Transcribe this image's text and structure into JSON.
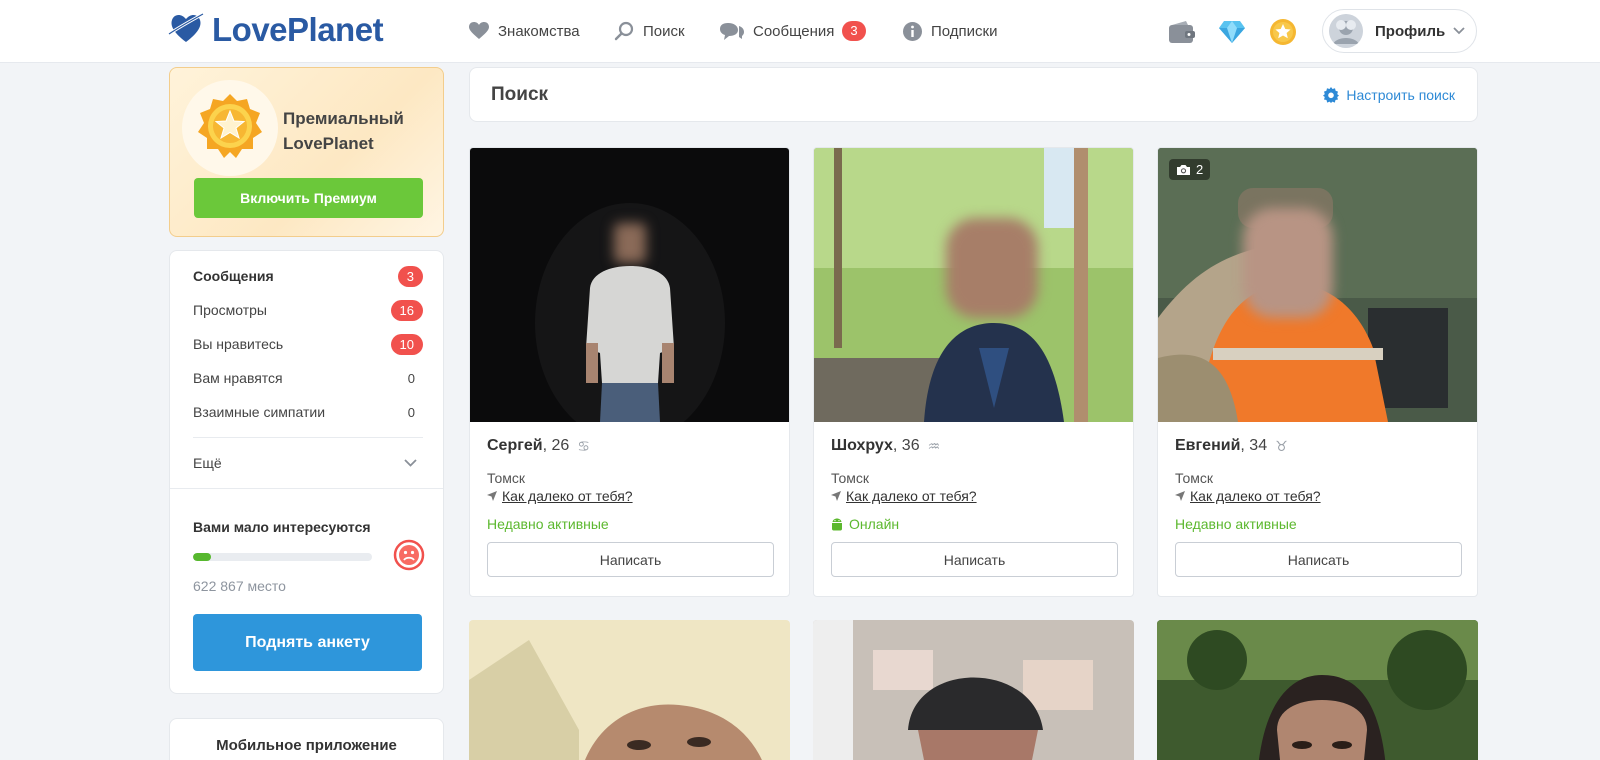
{
  "header": {
    "logo": "LovePlanet",
    "nav": [
      {
        "label": "Знакомства",
        "icon": "heart-icon"
      },
      {
        "label": "Поиск",
        "icon": "search-icon"
      },
      {
        "label": "Сообщения",
        "icon": "chat-bubbles-icon",
        "badge": "3"
      },
      {
        "label": "Подписки",
        "icon": "info-icon"
      }
    ],
    "icons": [
      "wallet-icon",
      "diamond-icon",
      "star-coin-icon"
    ],
    "profile_label": "Профиль"
  },
  "sidebar": {
    "premium": {
      "title_line1": "Премиальный",
      "title_line2": "LovePlanet",
      "button": "Включить Премиум"
    },
    "stats": [
      {
        "label": "Сообщения",
        "value": "3",
        "highlight": true
      },
      {
        "label": "Просмотры",
        "value": "16",
        "highlight": true
      },
      {
        "label": "Вы нравитесь",
        "value": "10",
        "highlight": true
      },
      {
        "label": "Вам нравятся",
        "value": "0",
        "highlight": false
      },
      {
        "label": "Взаимные симпатии",
        "value": "0",
        "highlight": false
      }
    ],
    "more_label": "Ещё",
    "interest": {
      "title": "Вами мало интересуются",
      "progress": 0.1,
      "rank": "622 867 место"
    },
    "raise_button": "Поднять анкету",
    "mobile_title": "Мобильное приложение"
  },
  "main": {
    "title": "Поиск",
    "settings_label": "Настроить поиск",
    "distance_link": "Как далеко от тебя?",
    "write_label": "Написать",
    "profiles": [
      {
        "name": "Сергей",
        "age": ", 26",
        "zodiac": "♋",
        "city": "Томск",
        "status": "Недавно активные",
        "online": false,
        "photo_count": ""
      },
      {
        "name": "Шохрух",
        "age": ", 36",
        "zodiac": "♒",
        "city": "Томск",
        "status": "Онлайн",
        "online": true,
        "photo_count": ""
      },
      {
        "name": "Евгений",
        "age": ", 34",
        "zodiac": "♉",
        "city": "Томск",
        "status": "Недавно активные",
        "online": false,
        "photo_count": "2"
      }
    ]
  },
  "colors": {
    "accent_blue": "#2e96db",
    "premium_green": "#6bc83a",
    "badge_red": "#f1514d",
    "status_green": "#5cb82e"
  }
}
